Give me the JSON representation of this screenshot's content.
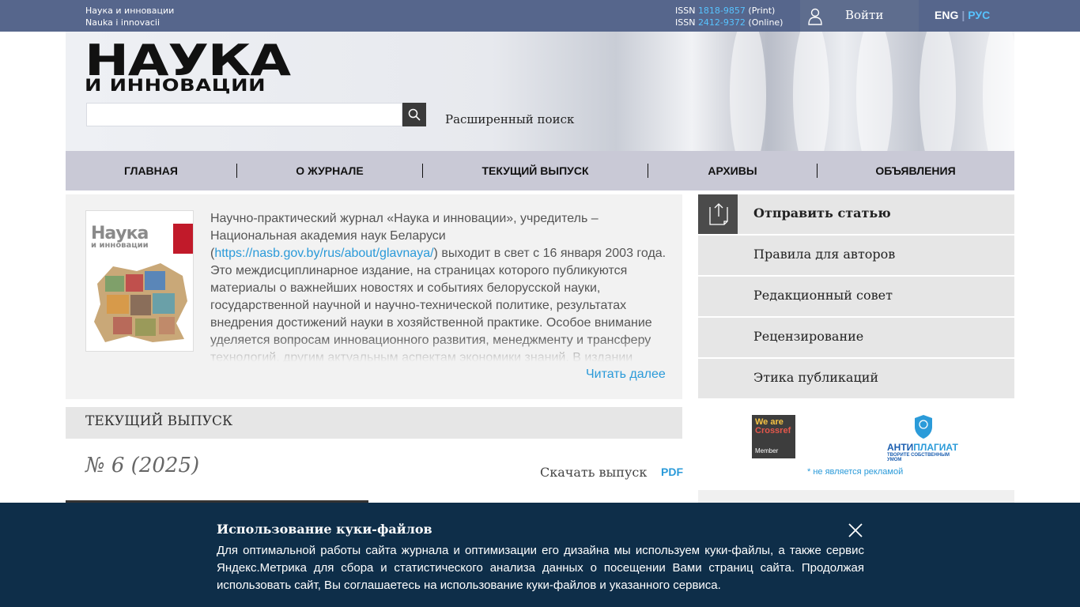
{
  "topbar": {
    "name_ru": "Наука и инновации",
    "name_by": "Nauka i innovacii",
    "issn_print_label": "ISSN",
    "issn_print": "1818-9857",
    "issn_print_type": "(Print)",
    "issn_online_label": "ISSN",
    "issn_online": "2412-9372",
    "issn_online_type": "(Online)",
    "login_label": "Войти",
    "lang_eng": "ENG",
    "lang_sep": "|",
    "lang_rus": "РУС"
  },
  "header": {
    "logo_big": "НАУКА",
    "logo_small": "И ИННОВАЦИИ",
    "search_placeholder": "",
    "advanced_search": "Расширенный поиск"
  },
  "nav": {
    "items": [
      "ГЛАВНАЯ",
      "О ЖУРНАЛЕ",
      "ТЕКУЩИЙ ВЫПУСК",
      "АРХИВЫ",
      "ОБЪЯВЛЕНИЯ"
    ]
  },
  "about": {
    "cover_title": "Наука",
    "cover_sub": "и инновации",
    "text_before_link": "Научно-практический журнал «Наука и инновации», учредитель – Национальная академия наук Беларуси (",
    "link": "https://nasb.gov.by/rus/about/glavnaya/",
    "text_after_link": ") выходит в свет с 16 января 2003 года. Это междисциплинарное издание, на страницах которого публикуются материалы о важнейших новостях и событиях белорусской науки, государственной научной и научно-технической политике, результатах внедрения достижений науки в хозяйственной практике. Особое внимание уделяется вопросам инновационного развития, менеджменту и трансферу технологий, другим актуальным аспектам экономики знаний. В издании",
    "read_more": "Читать далее"
  },
  "current_issue": {
    "heading": "ТЕКУЩИЙ ВЫПУСК",
    "number": "№ 6 (2025)",
    "download": "Скачать выпуск",
    "pdf": "PDF"
  },
  "sidebar": {
    "items": [
      "Отправить статью",
      "Правила для авторов",
      "Редакционный совет",
      "Рецензирование",
      "Этика публикаций"
    ],
    "crossref_line1": "We are",
    "crossref_line2": "Crossref",
    "crossref_member": "Member",
    "antiplagiat_a": "АНТИ",
    "antiplagiat_b": "ПЛАГИАТ",
    "antiplagiat_sub": "ТВОРИТЕ СОБСТВЕННЫМ УМОМ",
    "no_ad": "* не является рекламой"
  },
  "cookie": {
    "title": "Использование куки-файлов",
    "text": "Для оптимальной работы сайта журнала и оптимизации его дизайна мы используем куки-файлы, а также сервис Яндекс.Метрика для сбора и статистического анализа данных о посещении Вами страниц сайта. Продолжая использовать сайт, Вы соглашаетесь на использование куки-файлов и указанного сервиса."
  },
  "colors": {
    "topbar": "#56668c",
    "accent_link": "#2a9ad9",
    "issn_num": "#57c3ff",
    "nav_bg": "#c9c9d6",
    "cookie_bg": "#0e2e49"
  },
  "icons": [
    "user-icon",
    "search-icon",
    "upload-icon",
    "close-icon",
    "shield-icon"
  ]
}
